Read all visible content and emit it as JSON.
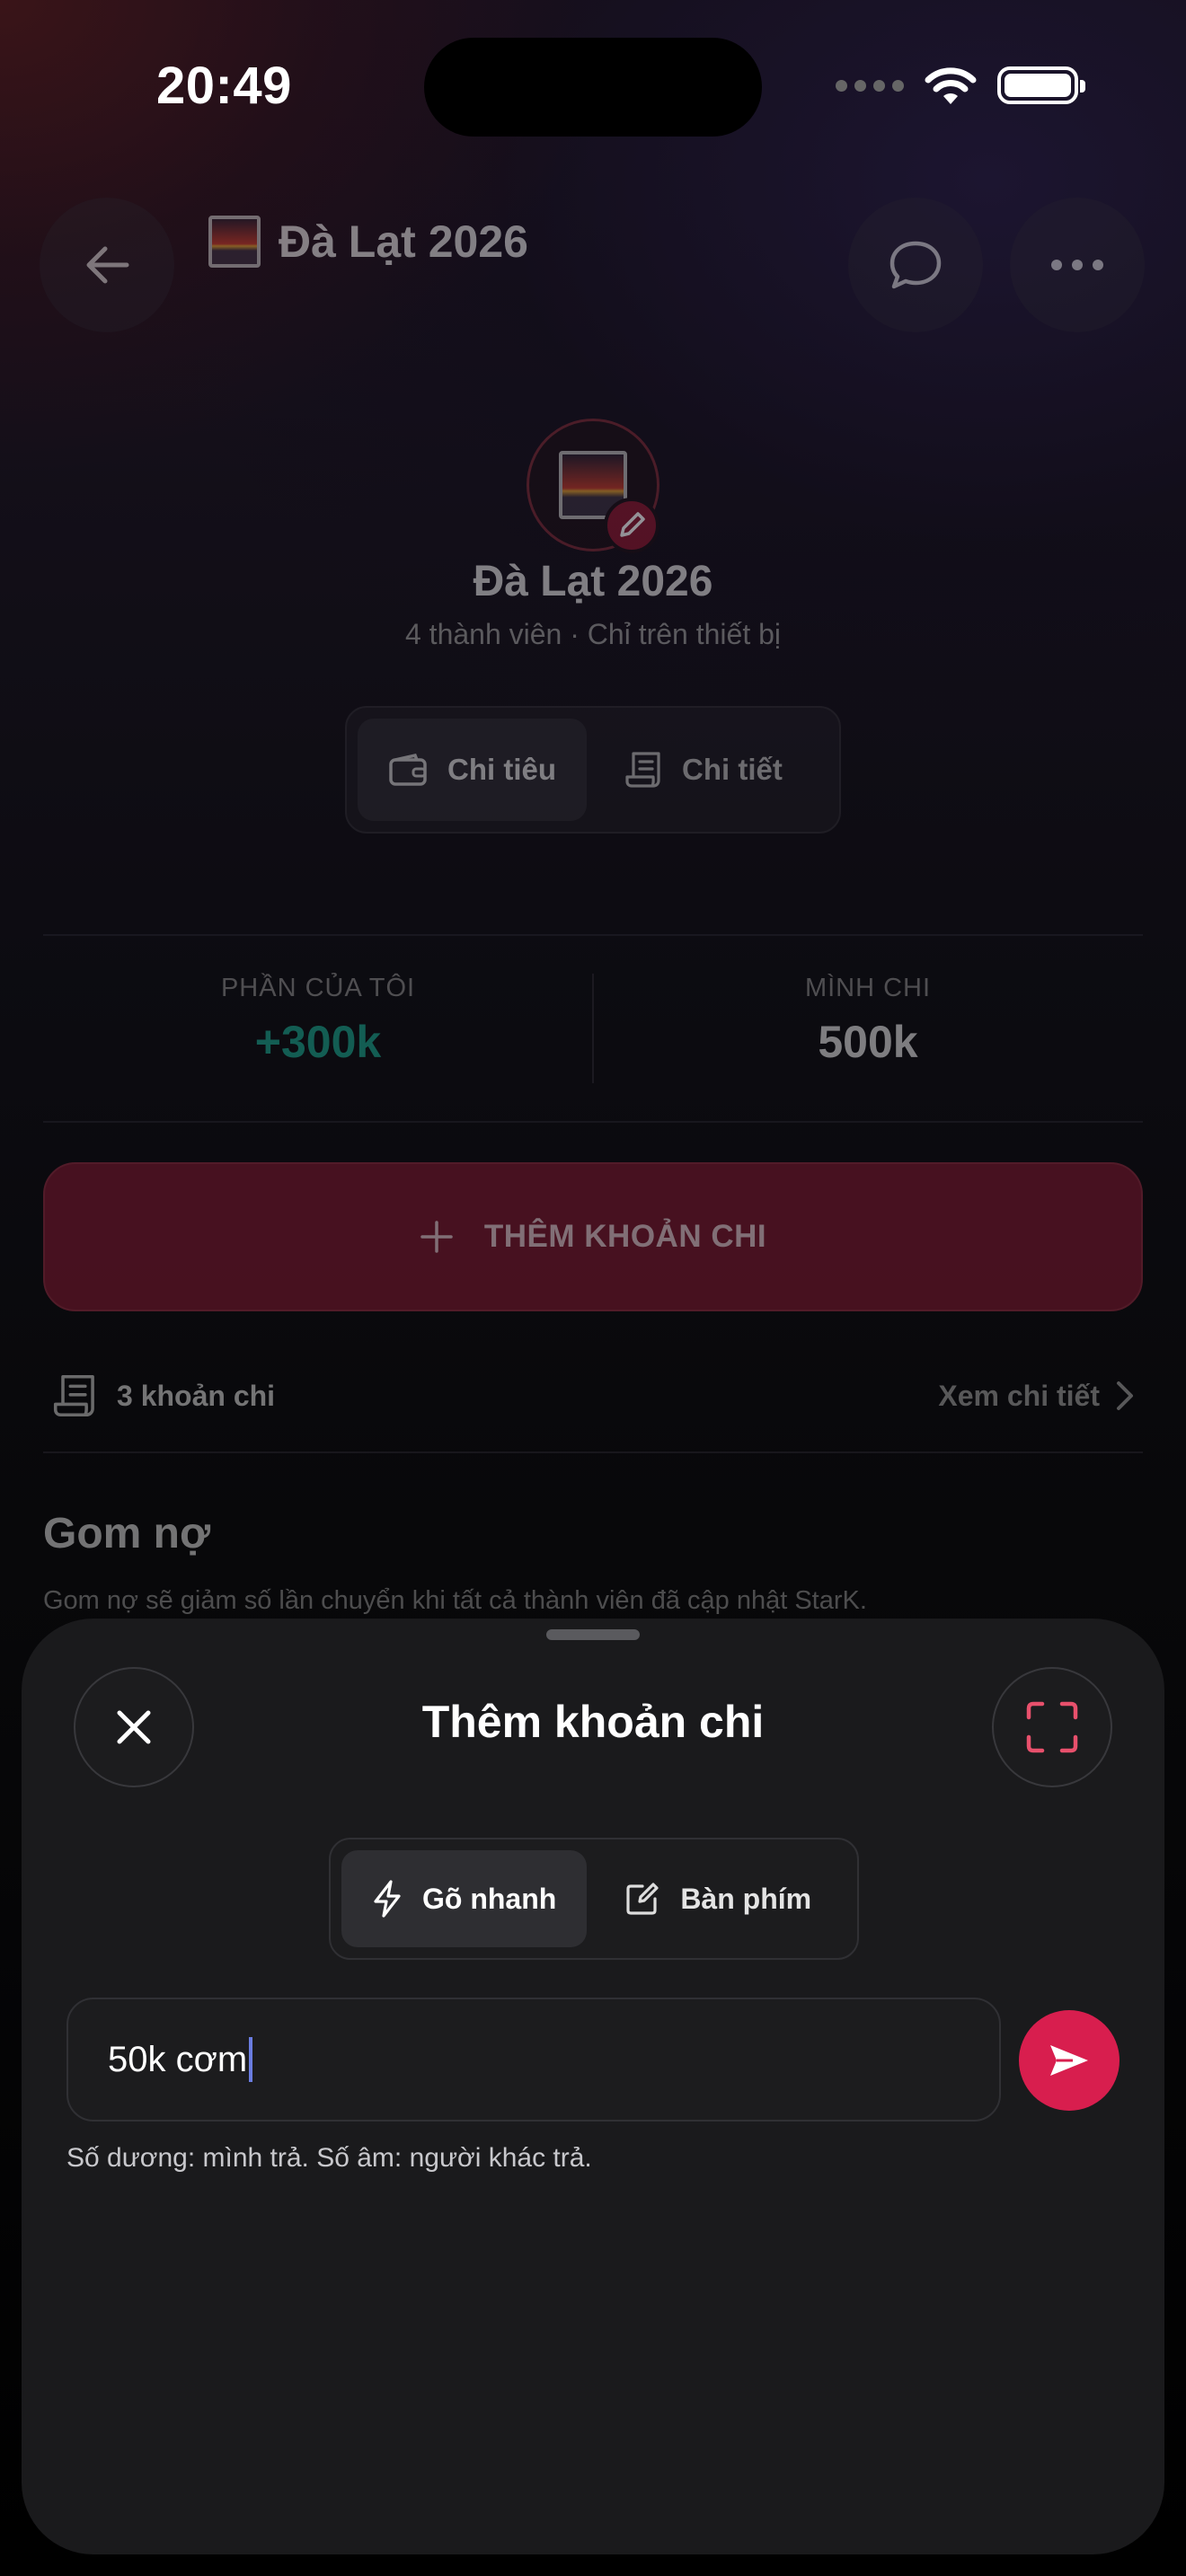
{
  "status_bar": {
    "time": "20:49"
  },
  "header": {
    "title": "Đà Lạt 2026"
  },
  "group": {
    "name": "Đà Lạt 2026",
    "subtitle": "4 thành viên · Chỉ trên thiết bị"
  },
  "view_tabs": [
    {
      "label": "Chi tiêu",
      "icon": "wallet-icon",
      "active": true
    },
    {
      "label": "Chi tiết",
      "icon": "receipt-icon",
      "active": false
    }
  ],
  "stats": {
    "my_share_label": "PHẦN CỦA TÔI",
    "my_share_value": "+300k",
    "my_share_color": "#1aa38a",
    "paid_label": "MÌNH CHI",
    "paid_value": "500k"
  },
  "add_expense_button": {
    "label": "THÊM KHOẢN CHI",
    "color": "#7a1830"
  },
  "expenses_row": {
    "count_label": "3 khoản chi",
    "link_label": "Xem chi tiết"
  },
  "debt_section": {
    "title": "Gom nợ",
    "description": "Gom nợ sẽ giảm số lần chuyển khi tất cả thành viên đã cập nhật StarK."
  },
  "sheet": {
    "title": "Thêm khoản chi",
    "modes": [
      {
        "label": "Gõ nhanh",
        "icon": "lightning-icon",
        "active": true
      },
      {
        "label": "Bàn phím",
        "icon": "edit-icon",
        "active": false
      }
    ],
    "input_value": "50k cơm",
    "hint": "Số dương: mình trả. Số âm: người khác trả.",
    "accent": "#d81e4e"
  }
}
